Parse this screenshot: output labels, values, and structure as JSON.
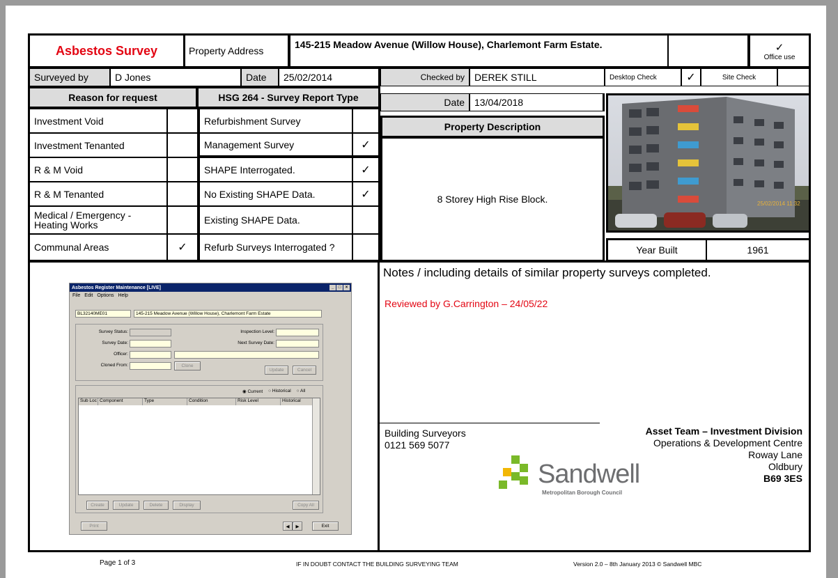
{
  "header": {
    "title": "Asbestos Survey",
    "property_address_label": "Property Address",
    "property_address": "145-215 Meadow Avenue (Willow House), Charlemont Farm Estate.",
    "office_use_tick": "✓",
    "office_use_label": "Office use"
  },
  "survey": {
    "surveyed_by_label": "Surveyed by",
    "surveyed_by": "D Jones",
    "date_label": "Date",
    "date": "25/02/2014",
    "checked_by_label": "Checked by",
    "checked_by": "DEREK STILL",
    "desktop_check_label": "Desktop Check",
    "desktop_check_tick": "✓",
    "site_check_label": "Site Check",
    "checked_date_label": "Date",
    "checked_date": "13/04/2018"
  },
  "reason": {
    "heading": "Reason for request",
    "items": [
      {
        "label": "Investment Void",
        "tick": ""
      },
      {
        "label": "Investment Tenanted",
        "tick": ""
      },
      {
        "label": "R & M Void",
        "tick": ""
      },
      {
        "label": "R & M Tenanted",
        "tick": ""
      },
      {
        "label": "Medical / Emergency - Heating Works",
        "tick": ""
      },
      {
        "label": "Communal Areas",
        "tick": "✓"
      }
    ]
  },
  "hsg": {
    "heading": "HSG 264 - Survey Report Type",
    "items": [
      {
        "label": "Refurbishment Survey",
        "tick": ""
      },
      {
        "label": "Management Survey",
        "tick": "✓"
      },
      {
        "label": "SHAPE Interrogated.",
        "tick": "✓"
      },
      {
        "label": "No Existing SHAPE Data.",
        "tick": "✓"
      },
      {
        "label": "Existing SHAPE Data.",
        "tick": ""
      },
      {
        "label": "Refurb Surveys Interrogated ?",
        "tick": ""
      }
    ]
  },
  "property": {
    "heading": "Property Description",
    "description": "8 Storey High Rise Block.",
    "photo_stamp": "25/02/2014 11:32",
    "year_built_label": "Year Built",
    "year_built": "1961"
  },
  "notes": {
    "heading_bold": "Notes",
    "heading_rest": " / including details of similar property surveys completed.",
    "review": "Reviewed by G.Carrington – 24/05/22"
  },
  "contact": {
    "dept": "Building Surveyors",
    "phone": "0121 569 5077",
    "team": "Asset Team – Investment Division",
    "addr1": "Operations & Development Centre",
    "addr2": "Roway Lane",
    "addr3": "Oldbury",
    "postcode": "B69 3ES",
    "logo_word": "Sandwell",
    "logo_sub": "Metropolitan Borough Council"
  },
  "app_window": {
    "title": "Asbestos Register Maintenance [LIVE]",
    "menu": [
      "File",
      "Edit",
      "Options",
      "Help"
    ],
    "ref": "BL32140ME01",
    "address": "145-215 Meadow Avenue (Willow House), Charlemont Farm Estate",
    "survey_status_label": "Survey Status:",
    "survey_date_label": "Survey Date:",
    "officer_label": "Officer:",
    "cloned_from_label": "Cloned From:",
    "inspection_level_label": "Inspection Level:",
    "next_survey_date_label": "Next Survey Date:",
    "clone_btn": "Clone",
    "update_btn": "Update",
    "cancel_btn": "Cancel",
    "radio_current": "Current",
    "radio_historical": "Historical",
    "radio_all": "All",
    "columns": [
      "Sub Loc",
      "Component",
      "Type",
      "Condition",
      "Risk Level",
      "Historical"
    ],
    "create_btn": "Create",
    "update2_btn": "Update",
    "delete_btn": "Delete",
    "display_btn": "Display",
    "copy_all_btn": "Copy All",
    "print_btn": "Print",
    "exit_btn": "Exit"
  },
  "footer": {
    "page": "Page 1 of 3",
    "advice": "IF IN DOUBT CONTACT THE BUILDING SURVEYING TEAM",
    "version": "Version 2.0 – 8th January 2013 © Sandwell MBC"
  },
  "colors": {
    "title_red": "#e30613",
    "logo_green": "#7ab929",
    "logo_grey": "#6d6e70"
  }
}
